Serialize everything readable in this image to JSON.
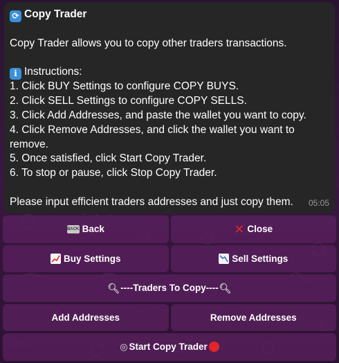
{
  "message": {
    "title": "Copy Trader",
    "title_icon": "repeat-icon",
    "intro": "Copy Trader allows you to copy other traders transactions.",
    "instructions_header": "Instructions:",
    "instructions_icon": "info-icon",
    "steps": [
      "1. Click BUY Settings to configure COPY BUYS.",
      "2. Click SELL Settings to configure COPY SELLS.",
      "3. Click Add Addresses, and paste the wallet you want to copy.",
      "4. Click Remove Addresses, and click the wallet you want to",
      "remove.",
      "5. Once satisfied, click Start Copy Trader.",
      "6. To stop or pause, click Stop Copy Trader."
    ],
    "footer": "Please input efficient traders addresses and just copy them.",
    "time": "05:05"
  },
  "keyboard": {
    "back": "Back",
    "close": "Close",
    "buy_settings": "Buy Settings",
    "sell_settings": "Sell Settings",
    "traders_to_copy": "----Traders To Copy----",
    "add_addresses": "Add Addresses",
    "remove_addresses": "Remove Addresses",
    "start_copy_trader": "Start Copy Trader",
    "back_icon_text": "BACK"
  },
  "colors": {
    "bubble": "#262626",
    "button": "#5a205f",
    "background": "#2a1331",
    "accent_red": "#e3242b"
  }
}
